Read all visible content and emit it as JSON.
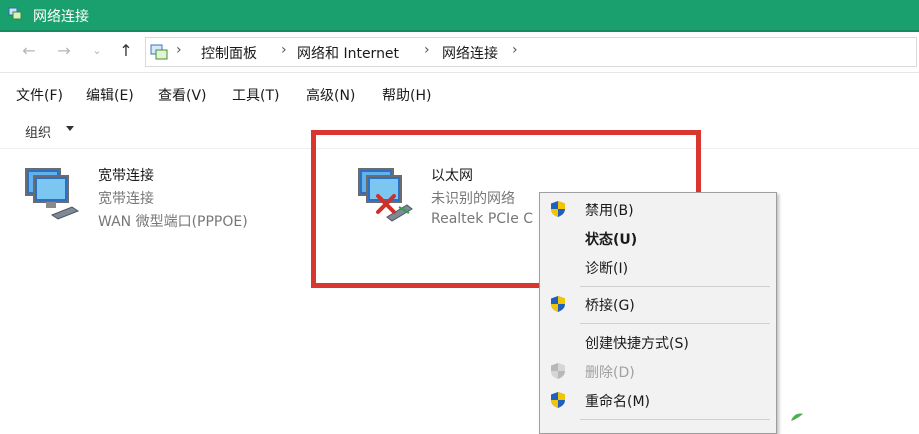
{
  "window": {
    "title": "网络连接",
    "accent_color": "#1aa06f"
  },
  "nav": {
    "back_icon": "arrow-left-icon",
    "forward_icon": "arrow-right-icon",
    "recent_icon": "chevron-down-icon",
    "up_icon": "arrow-up-icon",
    "breadcrumbs": [
      "控制面板",
      "网络和 Internet",
      "网络连接"
    ]
  },
  "menubar": {
    "items": [
      "文件(F)",
      "编辑(E)",
      "查看(V)",
      "工具(T)",
      "高级(N)",
      "帮助(H)"
    ]
  },
  "toolbar": {
    "organize_label": "组织"
  },
  "connections": [
    {
      "name": "宽带连接",
      "status": "宽带连接",
      "device": "WAN 微型端口(PPPOE)"
    },
    {
      "name": "以太网",
      "status": "未识别的网络",
      "device": "Realtek PCIe C"
    }
  ],
  "context_menu": {
    "items": [
      {
        "label": "禁用(B)",
        "shield": true
      },
      {
        "label": "状态(U)",
        "bold": true
      },
      {
        "label": "诊断(I)"
      },
      {
        "label": "桥接(G)",
        "shield": true
      },
      {
        "label": "创建快捷方式(S)"
      },
      {
        "label": "删除(D)",
        "shield": true,
        "disabled": true
      },
      {
        "label": "重命名(M)",
        "shield": true
      }
    ]
  },
  "colors": {
    "highlight_border": "#d9362f",
    "shield_blue": "#1f5fbf",
    "shield_yellow": "#f5c400"
  }
}
